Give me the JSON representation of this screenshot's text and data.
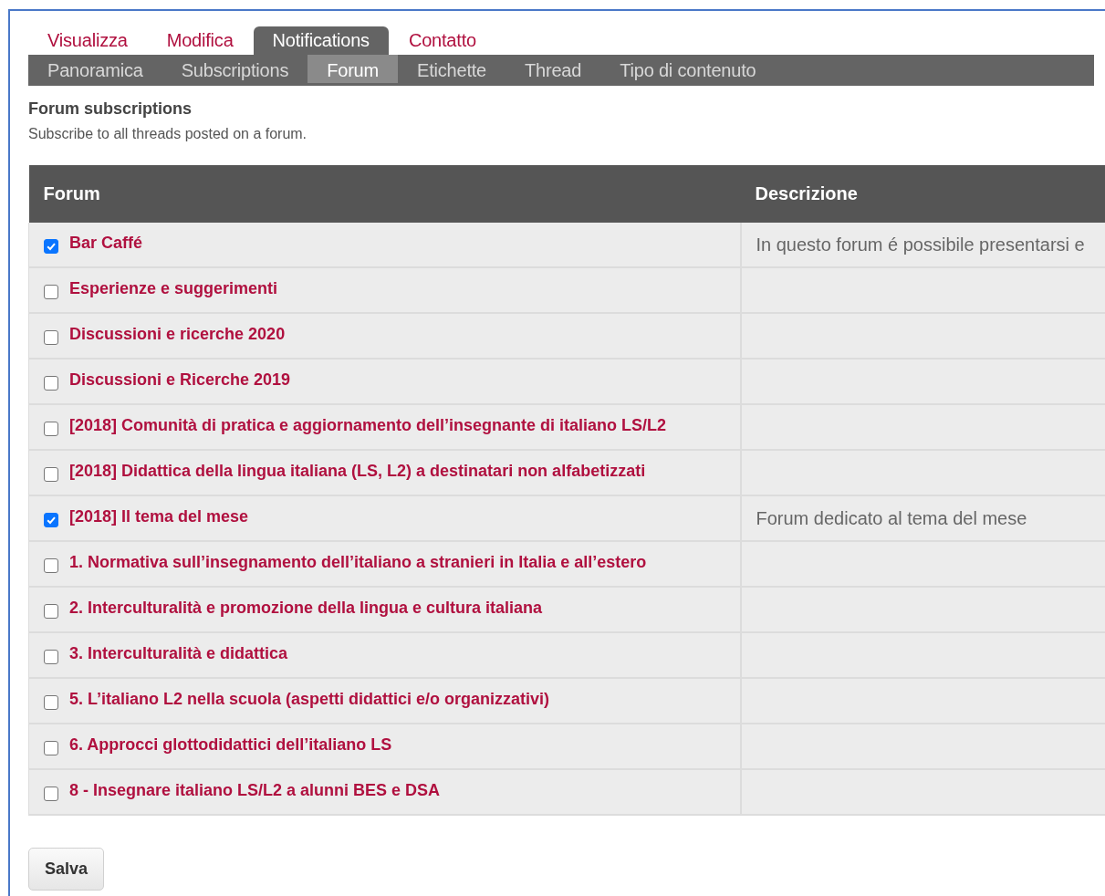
{
  "tabs": [
    {
      "label": "Visualizza",
      "selected": false
    },
    {
      "label": "Modifica",
      "selected": false
    },
    {
      "label": "Notifications",
      "selected": true
    },
    {
      "label": "Contatto",
      "selected": false
    }
  ],
  "subtabs": [
    {
      "label": "Panoramica",
      "selected": false
    },
    {
      "label": "Subscriptions",
      "selected": false
    },
    {
      "label": "Forum",
      "selected": true
    },
    {
      "label": "Etichette",
      "selected": false
    },
    {
      "label": "Thread",
      "selected": false
    },
    {
      "label": "Tipo di contenuto",
      "selected": false
    }
  ],
  "section": {
    "title": "Forum subscriptions",
    "description": "Subscribe to all threads posted on a forum."
  },
  "table": {
    "columns": [
      "Forum",
      "Descrizione"
    ],
    "rows": [
      {
        "forum": "Bar Caffé",
        "checked": true,
        "description": "In questo forum é possibile presentarsi e"
      },
      {
        "forum": "Esperienze e suggerimenti",
        "checked": false
      },
      {
        "forum": "Discussioni e ricerche 2020",
        "checked": false
      },
      {
        "forum": "Discussioni e Ricerche 2019",
        "checked": false
      },
      {
        "forum": "[2018] Comunità di pratica e aggiornamento dell’insegnante di italiano LS/L2",
        "checked": false
      },
      {
        "forum": "[2018] Didattica della lingua italiana (LS, L2) a destinatari non alfabetizzati",
        "checked": false
      },
      {
        "forum": "[2018] Il tema del mese",
        "checked": true,
        "description": "Forum dedicato al tema del mese"
      },
      {
        "forum": "1. Normativa sull’insegnamento dell’italiano a stranieri in Italia e all’estero",
        "checked": false
      },
      {
        "forum": "2. Interculturalità e promozione della lingua e cultura italiana",
        "checked": false
      },
      {
        "forum": "3. Interculturalità e didattica",
        "checked": false
      },
      {
        "forum": "5. L’italiano L2 nella scuola (aspetti didattici e/o organizzativi)",
        "checked": false
      },
      {
        "forum": "6. Approcci glottodidattici dell’italiano LS",
        "checked": false
      },
      {
        "forum": "8 - Insegnare italiano LS/L2 a alunni BES e DSA",
        "checked": false
      }
    ]
  },
  "save_button": "Salva"
}
